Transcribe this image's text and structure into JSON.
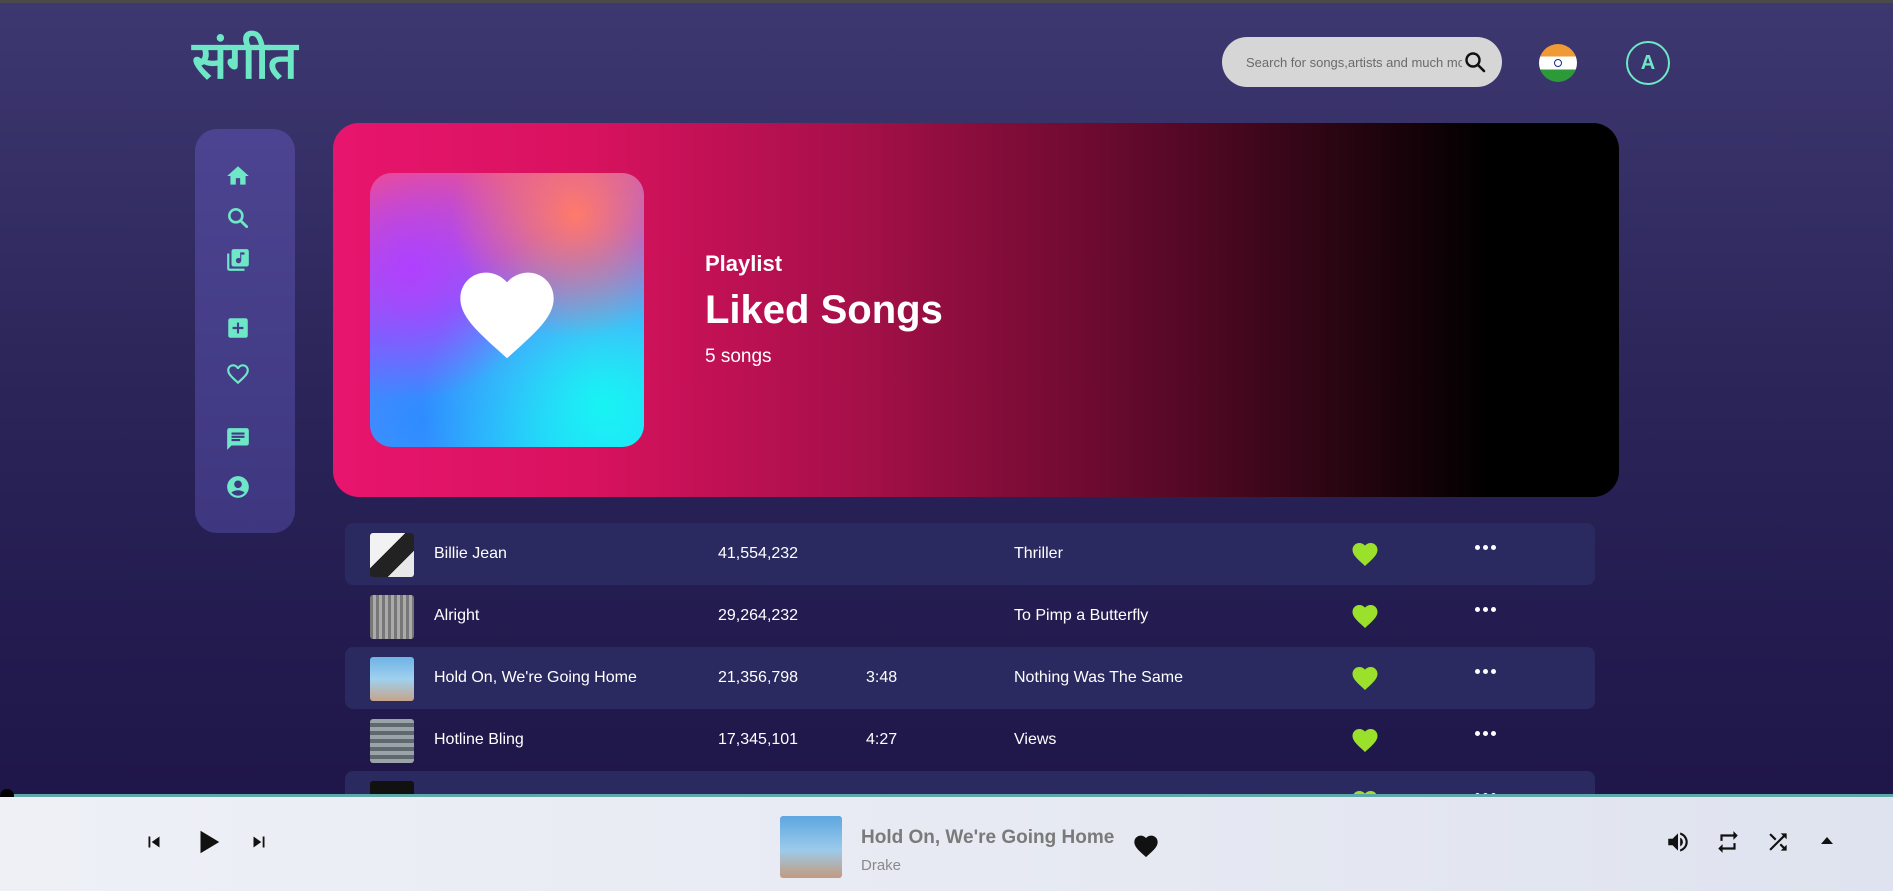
{
  "app": {
    "logo": "संगीत",
    "search_placeholder": "Search for songs,artists and much more",
    "avatar_letter": "A",
    "accent": "#6ee7c7"
  },
  "sidebar": {
    "items": [
      {
        "icon": "home-icon"
      },
      {
        "icon": "search-icon"
      },
      {
        "icon": "library-music-icon"
      },
      {
        "icon": "add-box-icon"
      },
      {
        "icon": "heart-outline-icon"
      },
      {
        "icon": "chat-icon"
      },
      {
        "icon": "account-circle-icon"
      }
    ]
  },
  "hero": {
    "kind": "Playlist",
    "title": "Liked Songs",
    "count": "5 songs"
  },
  "songs": [
    {
      "title": "Billie Jean",
      "plays": "41,554,232",
      "duration": "",
      "album": "Thriller",
      "liked": true
    },
    {
      "title": "Alright",
      "plays": "29,264,232",
      "duration": "",
      "album": "To Pimp a Butterfly",
      "liked": true
    },
    {
      "title": "Hold On, We're Going Home",
      "plays": "21,356,798",
      "duration": "3:48",
      "album": "Nothing Was The Same",
      "liked": true
    },
    {
      "title": "Hotline Bling",
      "plays": "17,345,101",
      "duration": "4:27",
      "album": "Views",
      "liked": true
    },
    {
      "title": "",
      "plays": "",
      "duration": "",
      "album": "",
      "liked": true
    }
  ],
  "player": {
    "title": "Hold On, We're Going Home",
    "artist": "Drake",
    "progress": 0,
    "like_color": "#9be02a"
  }
}
